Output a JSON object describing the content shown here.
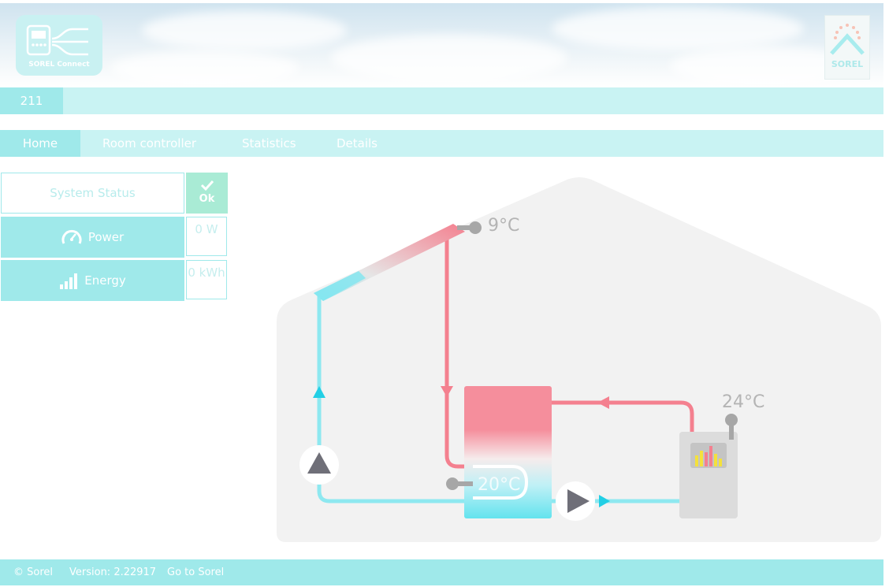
{
  "header": {
    "app_logo_text": "SOREL Connect",
    "brand_logo_text": "SOREL"
  },
  "device": {
    "id": "211"
  },
  "nav": {
    "tabs": [
      {
        "label": "Home",
        "active": true
      },
      {
        "label": "Room controller",
        "active": false
      },
      {
        "label": "Statistics",
        "active": false
      },
      {
        "label": "Details",
        "active": false
      }
    ]
  },
  "status": {
    "system_status_label": "System Status",
    "status_value": "Ok",
    "power_label": "Power",
    "power_value": "0 W",
    "energy_label": "Energy",
    "energy_value": "0 kWh"
  },
  "diagram": {
    "collector_temp": "9°C",
    "tank_temp": "20°C",
    "boiler_temp": "24°C"
  },
  "footer": {
    "copyright": "© Sorel",
    "version": "Version: 2.22917",
    "link": "Go to Sorel"
  },
  "colors": {
    "accent": "#9fe9ea",
    "accent_light": "#c9f3f3",
    "ok_green": "#a9ebd5",
    "hot": "#f4808f",
    "cold": "#8ee8f0",
    "house": "#f2f2f2"
  }
}
